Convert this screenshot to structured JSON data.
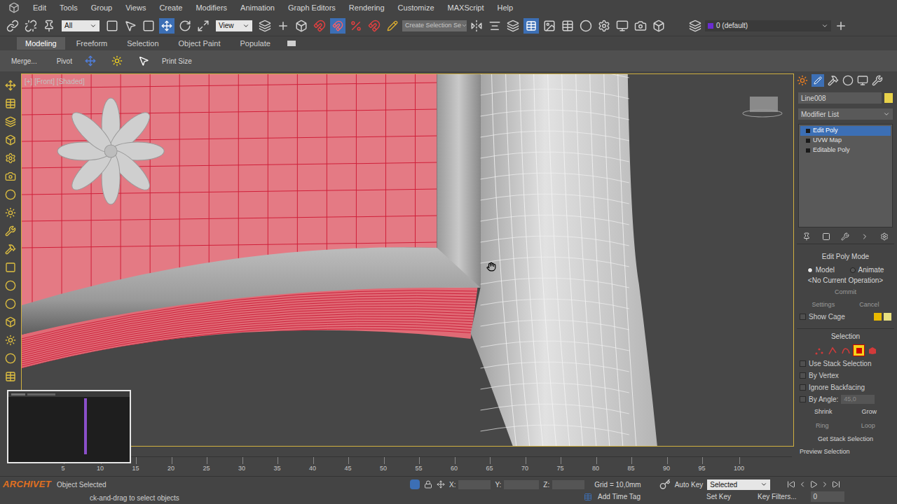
{
  "menu": [
    "Edit",
    "Tools",
    "Group",
    "Views",
    "Create",
    "Modifiers",
    "Animation",
    "Graph Editors",
    "Rendering",
    "Customize",
    "MAXScript",
    "Help"
  ],
  "toolbar": {
    "selection_filter": "All",
    "ref_coord": "View",
    "named_selection": "Create Selection Se",
    "layer": "0 (default)"
  },
  "ribbon": {
    "tabs": [
      {
        "label": "Modeling",
        "selected": true
      },
      {
        "label": "Freeform",
        "selected": false
      },
      {
        "label": "Selection",
        "selected": false
      },
      {
        "label": "Object Paint",
        "selected": false
      },
      {
        "label": "Populate",
        "selected": false
      }
    ],
    "buttons": [
      "Merge...",
      "Pivot",
      "Print Size"
    ]
  },
  "viewport": {
    "label": "[+] [Front] [Shaded]"
  },
  "command_panel": {
    "object_name": "Line008",
    "object_color": "#e8d24a",
    "modifier_list": "Modifier List",
    "stack": [
      {
        "label": "Edit Poly",
        "selected": true
      },
      {
        "label": "UVW Map",
        "selected": false
      },
      {
        "label": "Editable Poly",
        "selected": false
      }
    ],
    "edit_poly_mode": {
      "title": "Edit Poly Mode",
      "modes": [
        {
          "label": "Model",
          "selected": true
        },
        {
          "label": "Animate",
          "selected": false
        }
      ],
      "operation": "<No Current Operation>",
      "commit": "Commit",
      "settings": "Settings",
      "cancel": "Cancel",
      "show_cage": {
        "label": "Show Cage",
        "checked": false
      }
    },
    "selection": {
      "title": "Selection",
      "levels": [
        {
          "kind": "vertex",
          "selected": false
        },
        {
          "kind": "edge",
          "selected": false
        },
        {
          "kind": "border",
          "selected": false
        },
        {
          "kind": "polygon",
          "selected": true
        },
        {
          "kind": "element",
          "selected": false
        }
      ],
      "options": [
        {
          "label": "Use Stack Selection",
          "checked": false
        },
        {
          "label": "By Vertex",
          "checked": false
        },
        {
          "label": "Ignore Backfacing",
          "checked": false
        },
        {
          "label": "By Angle:",
          "checked": false
        }
      ],
      "angle": "45,0",
      "shrink": "Shrink",
      "grow": "Grow",
      "ring": "Ring",
      "loop": "Loop",
      "get_stack": "Get Stack Selection",
      "preview": "Preview Selection"
    }
  },
  "timeline": {
    "ticks": [
      "5",
      "10",
      "15",
      "20",
      "25",
      "30",
      "35",
      "40",
      "45",
      "50",
      "55",
      "60",
      "65",
      "70",
      "75",
      "80",
      "85",
      "90",
      "95",
      "100"
    ]
  },
  "status_bar": {
    "watermark": "ARCHIVET",
    "selected_text": "Object Selected",
    "prompt": "ck-and-drag to select objects",
    "x": "X:",
    "y": "Y:",
    "z": "Z:",
    "grid": "Grid = 10,0mm",
    "add_time_tag": "Add Time Tag",
    "auto_key": "Auto Key",
    "set_key": "Set Key",
    "key_mode": "Selected",
    "key_filters": "Key Filters...",
    "frame": "0"
  }
}
